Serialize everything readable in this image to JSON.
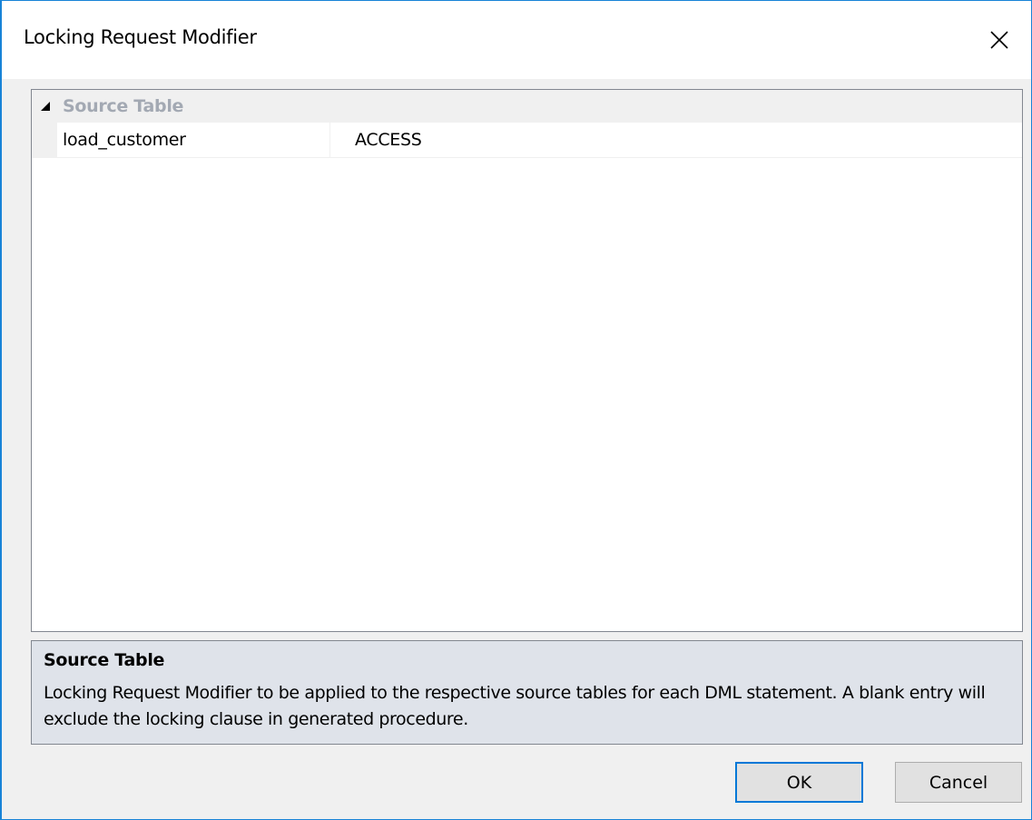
{
  "window": {
    "title": "Locking Request Modifier",
    "close_icon": "close-icon"
  },
  "property_grid": {
    "category": {
      "label": "Source Table",
      "expanded": true,
      "toggle_icon": "collapse-triangle-icon"
    },
    "rows": [
      {
        "name": "load_customer",
        "value": "ACCESS"
      }
    ]
  },
  "help": {
    "title": "Source Table",
    "description": "Locking Request Modifier to be applied to the respective source tables for each DML statement. A blank entry will exclude the locking clause in generated procedure."
  },
  "buttons": {
    "ok_label": "OK",
    "cancel_label": "Cancel"
  },
  "colors": {
    "window_border": "#1883d7",
    "category_text": "#a3a9b3",
    "help_background": "#dfe3ea",
    "default_button_border": "#0078d7"
  }
}
